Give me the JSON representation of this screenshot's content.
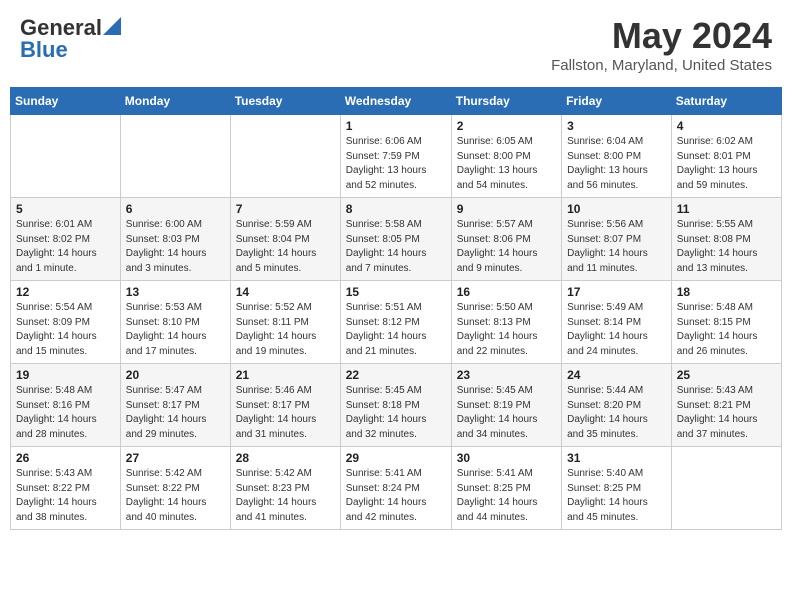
{
  "header": {
    "logo_general": "General",
    "logo_blue": "Blue",
    "month_title": "May 2024",
    "location": "Fallston, Maryland, United States"
  },
  "weekdays": [
    "Sunday",
    "Monday",
    "Tuesday",
    "Wednesday",
    "Thursday",
    "Friday",
    "Saturday"
  ],
  "weeks": [
    [
      {
        "day": "",
        "info": ""
      },
      {
        "day": "",
        "info": ""
      },
      {
        "day": "",
        "info": ""
      },
      {
        "day": "1",
        "info": "Sunrise: 6:06 AM\nSunset: 7:59 PM\nDaylight: 13 hours\nand 52 minutes."
      },
      {
        "day": "2",
        "info": "Sunrise: 6:05 AM\nSunset: 8:00 PM\nDaylight: 13 hours\nand 54 minutes."
      },
      {
        "day": "3",
        "info": "Sunrise: 6:04 AM\nSunset: 8:00 PM\nDaylight: 13 hours\nand 56 minutes."
      },
      {
        "day": "4",
        "info": "Sunrise: 6:02 AM\nSunset: 8:01 PM\nDaylight: 13 hours\nand 59 minutes."
      }
    ],
    [
      {
        "day": "5",
        "info": "Sunrise: 6:01 AM\nSunset: 8:02 PM\nDaylight: 14 hours\nand 1 minute."
      },
      {
        "day": "6",
        "info": "Sunrise: 6:00 AM\nSunset: 8:03 PM\nDaylight: 14 hours\nand 3 minutes."
      },
      {
        "day": "7",
        "info": "Sunrise: 5:59 AM\nSunset: 8:04 PM\nDaylight: 14 hours\nand 5 minutes."
      },
      {
        "day": "8",
        "info": "Sunrise: 5:58 AM\nSunset: 8:05 PM\nDaylight: 14 hours\nand 7 minutes."
      },
      {
        "day": "9",
        "info": "Sunrise: 5:57 AM\nSunset: 8:06 PM\nDaylight: 14 hours\nand 9 minutes."
      },
      {
        "day": "10",
        "info": "Sunrise: 5:56 AM\nSunset: 8:07 PM\nDaylight: 14 hours\nand 11 minutes."
      },
      {
        "day": "11",
        "info": "Sunrise: 5:55 AM\nSunset: 8:08 PM\nDaylight: 14 hours\nand 13 minutes."
      }
    ],
    [
      {
        "day": "12",
        "info": "Sunrise: 5:54 AM\nSunset: 8:09 PM\nDaylight: 14 hours\nand 15 minutes."
      },
      {
        "day": "13",
        "info": "Sunrise: 5:53 AM\nSunset: 8:10 PM\nDaylight: 14 hours\nand 17 minutes."
      },
      {
        "day": "14",
        "info": "Sunrise: 5:52 AM\nSunset: 8:11 PM\nDaylight: 14 hours\nand 19 minutes."
      },
      {
        "day": "15",
        "info": "Sunrise: 5:51 AM\nSunset: 8:12 PM\nDaylight: 14 hours\nand 21 minutes."
      },
      {
        "day": "16",
        "info": "Sunrise: 5:50 AM\nSunset: 8:13 PM\nDaylight: 14 hours\nand 22 minutes."
      },
      {
        "day": "17",
        "info": "Sunrise: 5:49 AM\nSunset: 8:14 PM\nDaylight: 14 hours\nand 24 minutes."
      },
      {
        "day": "18",
        "info": "Sunrise: 5:48 AM\nSunset: 8:15 PM\nDaylight: 14 hours\nand 26 minutes."
      }
    ],
    [
      {
        "day": "19",
        "info": "Sunrise: 5:48 AM\nSunset: 8:16 PM\nDaylight: 14 hours\nand 28 minutes."
      },
      {
        "day": "20",
        "info": "Sunrise: 5:47 AM\nSunset: 8:17 PM\nDaylight: 14 hours\nand 29 minutes."
      },
      {
        "day": "21",
        "info": "Sunrise: 5:46 AM\nSunset: 8:17 PM\nDaylight: 14 hours\nand 31 minutes."
      },
      {
        "day": "22",
        "info": "Sunrise: 5:45 AM\nSunset: 8:18 PM\nDaylight: 14 hours\nand 32 minutes."
      },
      {
        "day": "23",
        "info": "Sunrise: 5:45 AM\nSunset: 8:19 PM\nDaylight: 14 hours\nand 34 minutes."
      },
      {
        "day": "24",
        "info": "Sunrise: 5:44 AM\nSunset: 8:20 PM\nDaylight: 14 hours\nand 35 minutes."
      },
      {
        "day": "25",
        "info": "Sunrise: 5:43 AM\nSunset: 8:21 PM\nDaylight: 14 hours\nand 37 minutes."
      }
    ],
    [
      {
        "day": "26",
        "info": "Sunrise: 5:43 AM\nSunset: 8:22 PM\nDaylight: 14 hours\nand 38 minutes."
      },
      {
        "day": "27",
        "info": "Sunrise: 5:42 AM\nSunset: 8:22 PM\nDaylight: 14 hours\nand 40 minutes."
      },
      {
        "day": "28",
        "info": "Sunrise: 5:42 AM\nSunset: 8:23 PM\nDaylight: 14 hours\nand 41 minutes."
      },
      {
        "day": "29",
        "info": "Sunrise: 5:41 AM\nSunset: 8:24 PM\nDaylight: 14 hours\nand 42 minutes."
      },
      {
        "day": "30",
        "info": "Sunrise: 5:41 AM\nSunset: 8:25 PM\nDaylight: 14 hours\nand 44 minutes."
      },
      {
        "day": "31",
        "info": "Sunrise: 5:40 AM\nSunset: 8:25 PM\nDaylight: 14 hours\nand 45 minutes."
      },
      {
        "day": "",
        "info": ""
      }
    ]
  ]
}
